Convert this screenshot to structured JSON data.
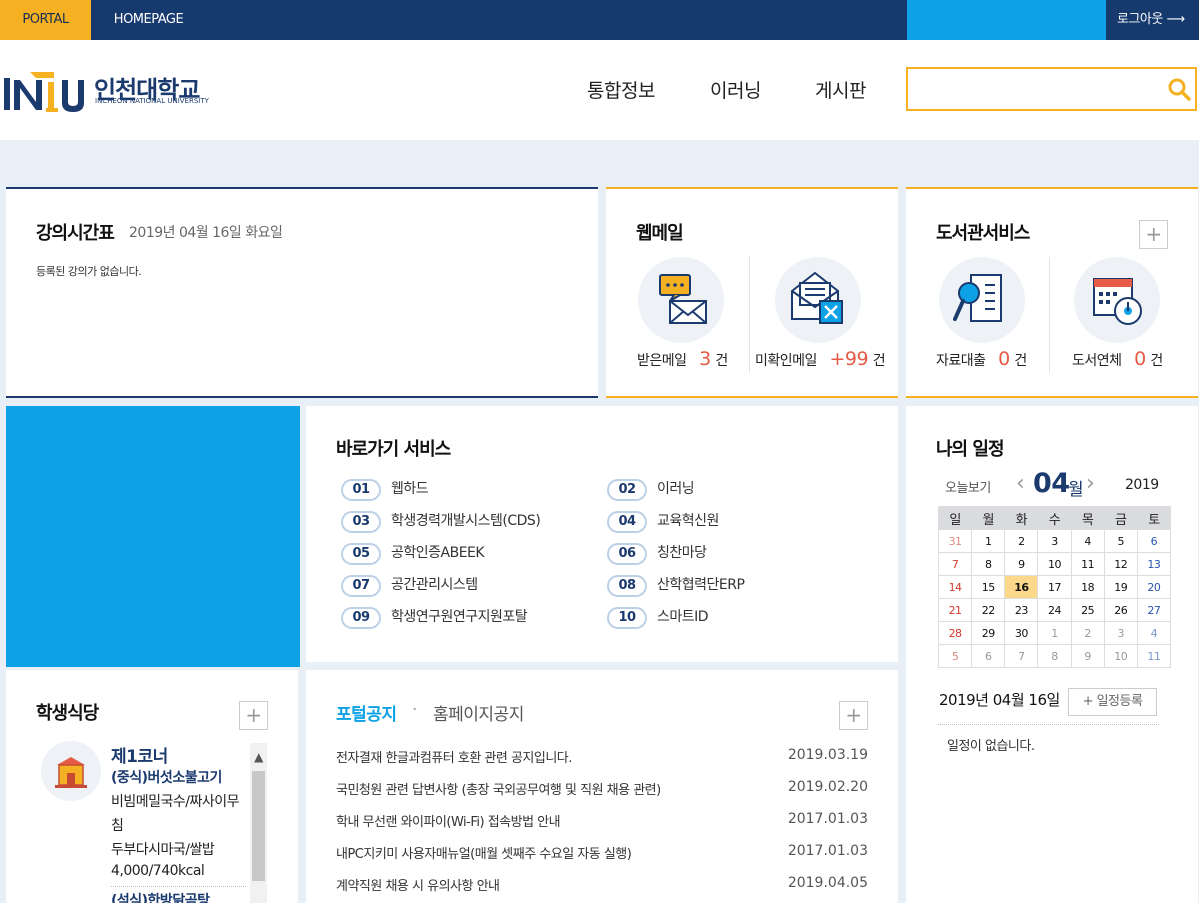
{
  "topbar": {
    "portal": "PORTAL",
    "homepage": "HOMEPAGE",
    "logout": "로그아웃"
  },
  "header": {
    "logo_title": "인천대학교",
    "logo_sub": "INCHEON NATIONAL UNIVERSITY",
    "nav": [
      "통합정보",
      "이러닝",
      "게시판"
    ],
    "search_placeholder": ""
  },
  "timetable": {
    "title": "강의시간표",
    "date": "2019년 04월 16일 화요일",
    "empty": "등록된 강의가 없습니다."
  },
  "webmail": {
    "title": "웹메일",
    "items": [
      {
        "label": "받은메일",
        "count": "3",
        "unit": "건"
      },
      {
        "label": "미확인메일",
        "count": "+99",
        "unit": "건"
      }
    ]
  },
  "library": {
    "title": "도서관서비스",
    "plus": "+",
    "items": [
      {
        "label": "자료대출",
        "count": "0",
        "unit": "건"
      },
      {
        "label": "도서연체",
        "count": "0",
        "unit": "건"
      }
    ]
  },
  "shortcuts": {
    "title": "바로가기 서비스",
    "items": [
      {
        "num": "01",
        "label": "웹하드"
      },
      {
        "num": "02",
        "label": "이러닝"
      },
      {
        "num": "03",
        "label": "학생경력개발시스템(CDS)"
      },
      {
        "num": "04",
        "label": "교육혁신원"
      },
      {
        "num": "05",
        "label": "공학인증ABEEK"
      },
      {
        "num": "06",
        "label": "칭찬마당"
      },
      {
        "num": "07",
        "label": "공간관리시스템"
      },
      {
        "num": "08",
        "label": "산학협력단ERP"
      },
      {
        "num": "09",
        "label": "학생연구원연구지원포탈"
      },
      {
        "num": "10",
        "label": "스마트ID"
      }
    ]
  },
  "schedule": {
    "title": "나의 일정",
    "today_btn": "오늘보기",
    "month": "04",
    "month_unit": "월",
    "year": "2019",
    "weekdays": [
      "일",
      "월",
      "화",
      "수",
      "목",
      "금",
      "토"
    ],
    "weeks": [
      [
        "31",
        "1",
        "2",
        "3",
        "4",
        "5",
        "6"
      ],
      [
        "7",
        "8",
        "9",
        "10",
        "11",
        "12",
        "13"
      ],
      [
        "14",
        "15",
        "16",
        "17",
        "18",
        "19",
        "20"
      ],
      [
        "21",
        "22",
        "23",
        "24",
        "25",
        "26",
        "27"
      ],
      [
        "28",
        "29",
        "30",
        "1",
        "2",
        "3",
        "4"
      ],
      [
        "5",
        "6",
        "7",
        "8",
        "9",
        "10",
        "11"
      ]
    ],
    "selected_date": "2019년 04월 16일",
    "add_btn": "+ 일정등록",
    "empty": "일정이 없습니다.",
    "colors": {
      "sunday": "#d33a2c",
      "saturday": "#2a56b0",
      "other_month": "#999999",
      "today_bg": "#fcd98a"
    }
  },
  "cafeteria": {
    "title": "학생식당",
    "plus": "+",
    "corner": "제1코너",
    "items": [
      {
        "text": "(중식)버섯소불고기",
        "highlight": true
      },
      {
        "text": "비빔메밀국수/짜사이무",
        "highlight": false
      },
      {
        "text": "침",
        "highlight": false
      },
      {
        "text": "두부다시마국/쌀밥",
        "highlight": false
      },
      {
        "text": "4,000/740kcal",
        "highlight": false
      },
      {
        "text": "(석식)한방닭곰탕",
        "highlight": true
      }
    ]
  },
  "notices": {
    "tabs": [
      "포털공지",
      "홈페이지공지"
    ],
    "separator": "·",
    "plus": "+",
    "items": [
      {
        "title": "전자결재 한글과컴퓨터 호환 관련 공지입니다.",
        "date": "2019.03.19"
      },
      {
        "title": "국민청원 관련 답변사항 (총장 국외공무여행 및 직원 채용 관련)",
        "date": "2019.02.20"
      },
      {
        "title": "학내 무선랜 와이파이(Wi-Fi) 접속방법 안내",
        "date": "2017.01.03"
      },
      {
        "title": "내PC지키미 사용자매뉴얼(매월 셋째주 수요일 자동 실행)",
        "date": "2017.01.03"
      },
      {
        "title": "계약직원 채용 시 유의사항 안내",
        "date": "2019.04.05"
      }
    ]
  },
  "colors": {
    "navy": "#173a6e",
    "yellow": "#f5b122",
    "sky": "#0ca2e5",
    "accent_red": "#e55b46"
  }
}
